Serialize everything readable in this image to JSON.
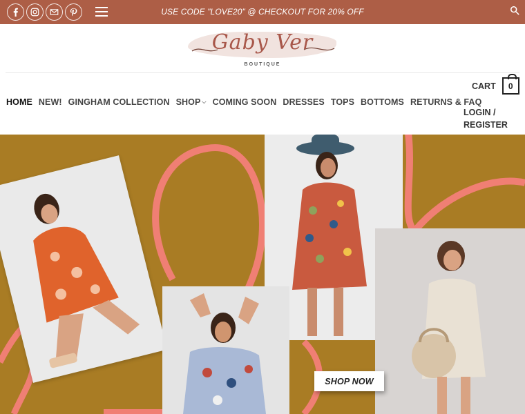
{
  "topbar": {
    "promo": "USE CODE \"LOVE20\" @ CHECKOUT FOR 20% OFF",
    "social_icons": [
      "facebook-icon",
      "instagram-icon",
      "email-icon",
      "pinterest-icon"
    ],
    "bg_color": "#ad5e46"
  },
  "logo": {
    "name": "Gaby Ver",
    "sub": "BOUTIQUE"
  },
  "nav": {
    "items": [
      {
        "label": "HOME",
        "active": true
      },
      {
        "label": "NEW!"
      },
      {
        "label": "GINGHAM COLLECTION"
      },
      {
        "label": "SHOP",
        "has_dropdown": true
      },
      {
        "label": "COMING SOON"
      },
      {
        "label": "DRESSES"
      },
      {
        "label": "TOPS"
      },
      {
        "label": "BOTTOMS"
      },
      {
        "label": "RETURNS & FAQ"
      }
    ],
    "cart_label": "CART",
    "cart_count": "0",
    "login_line1": "LOGIN /",
    "login_line2": "REGISTER"
  },
  "hero": {
    "cta": "SHOP NOW",
    "bg_color": "#a97c24",
    "accent_color": "#f07f74"
  }
}
